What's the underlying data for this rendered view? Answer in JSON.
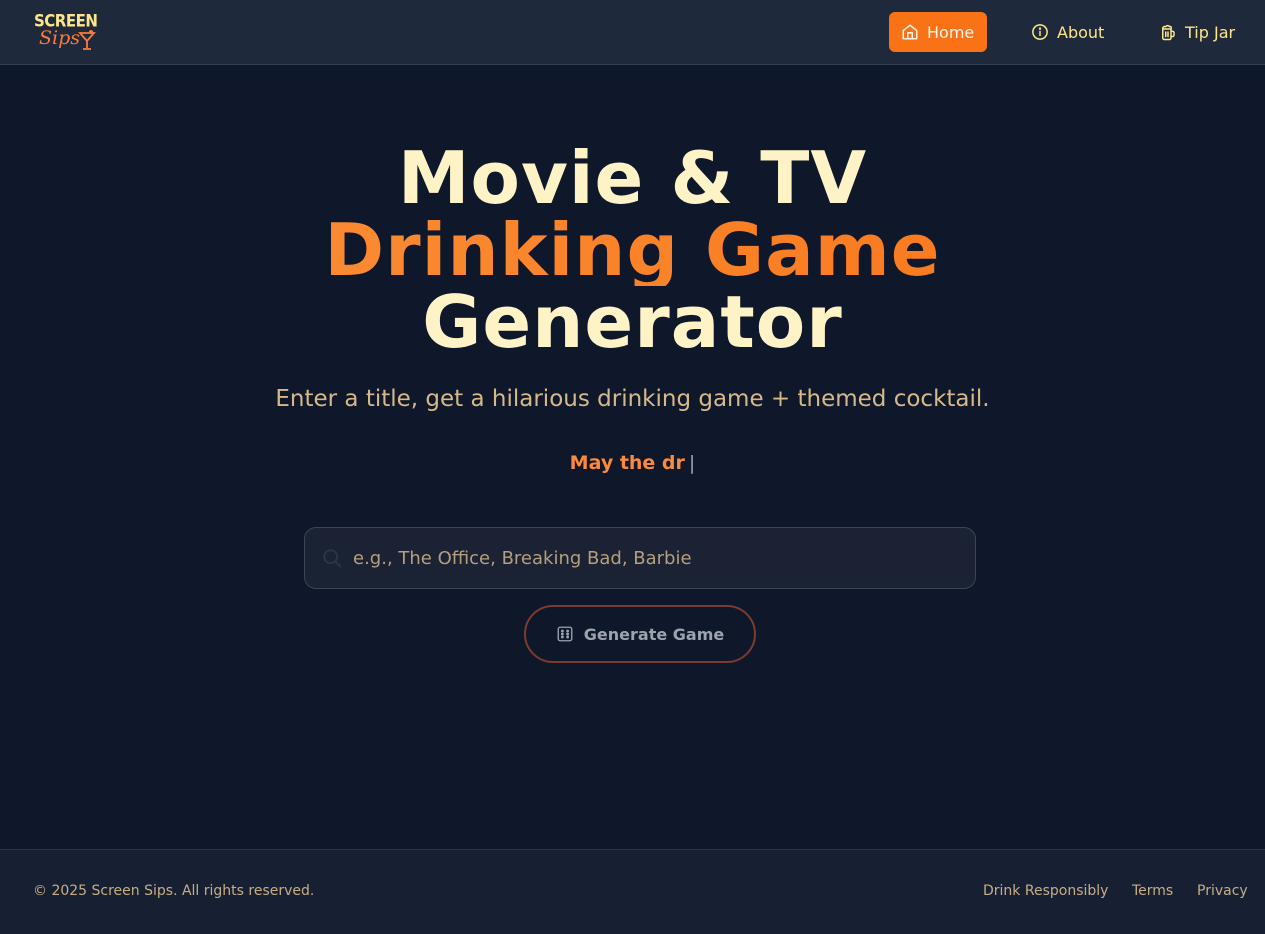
{
  "header": {
    "logo": {
      "top": "SCREEN",
      "bottom": "Sips"
    },
    "nav": [
      {
        "label": "Home",
        "icon": "home-icon",
        "active": true
      },
      {
        "label": "About",
        "icon": "info-icon",
        "active": false
      },
      {
        "label": "Tip Jar",
        "icon": "beer-mug-icon",
        "active": false
      }
    ]
  },
  "hero": {
    "title_line1": "Movie & TV",
    "title_line2": "Drinking Game",
    "title_line3": "Generator",
    "subtitle": "Enter a title, get a hilarious drinking game + themed cocktail.",
    "typing_text": "May the dr",
    "typing_cursor": "|"
  },
  "search": {
    "placeholder": "e.g., The Office, Breaking Bad, Barbie",
    "value": "",
    "icon": "search-icon"
  },
  "generate_button": {
    "label": "Generate Game",
    "icon": "dice-icon"
  },
  "footer": {
    "copyright": "© 2025 Screen Sips. All rights reserved.",
    "links": [
      "Drink Responsibly",
      "Terms",
      "Privacy"
    ]
  },
  "colors": {
    "background": "#0f172a",
    "header_bg": "#1e293b",
    "accent": "#f97316",
    "title_text": "#fef3c7",
    "muted_text": "#d6b98a"
  }
}
